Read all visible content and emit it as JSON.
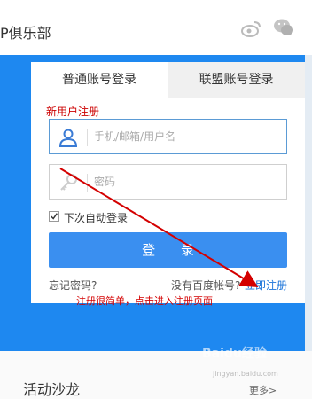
{
  "header": {
    "title": "P俱乐部",
    "icons": [
      "weibo-icon",
      "wechat-icon"
    ]
  },
  "login": {
    "tabs": [
      {
        "label": "普通账号登录",
        "active": true
      },
      {
        "label": "联盟账号登录",
        "active": false
      }
    ],
    "new_user_label": "新用户注册",
    "username_placeholder": "手机/邮箱/用户名",
    "password_placeholder": "密码",
    "auto_login_label": "下次自动登录",
    "auto_login_checked": true,
    "submit_label": "登 录",
    "forgot_label": "忘记密码?",
    "no_account_label": "没有百度帐号?",
    "register_label": "立即注册"
  },
  "annotation": {
    "note": "注册很简单，点击进入注册页面"
  },
  "section": {
    "title": "活动沙龙",
    "more_label": "更多>"
  },
  "watermark": {
    "text": "Baidu经验",
    "sub": "jingyan.baidu.com"
  },
  "colors": {
    "brand_blue": "#1e88f0",
    "button_blue": "#3a8ff0",
    "annotation_red": "#d40000",
    "link_blue": "#1a73d9"
  }
}
